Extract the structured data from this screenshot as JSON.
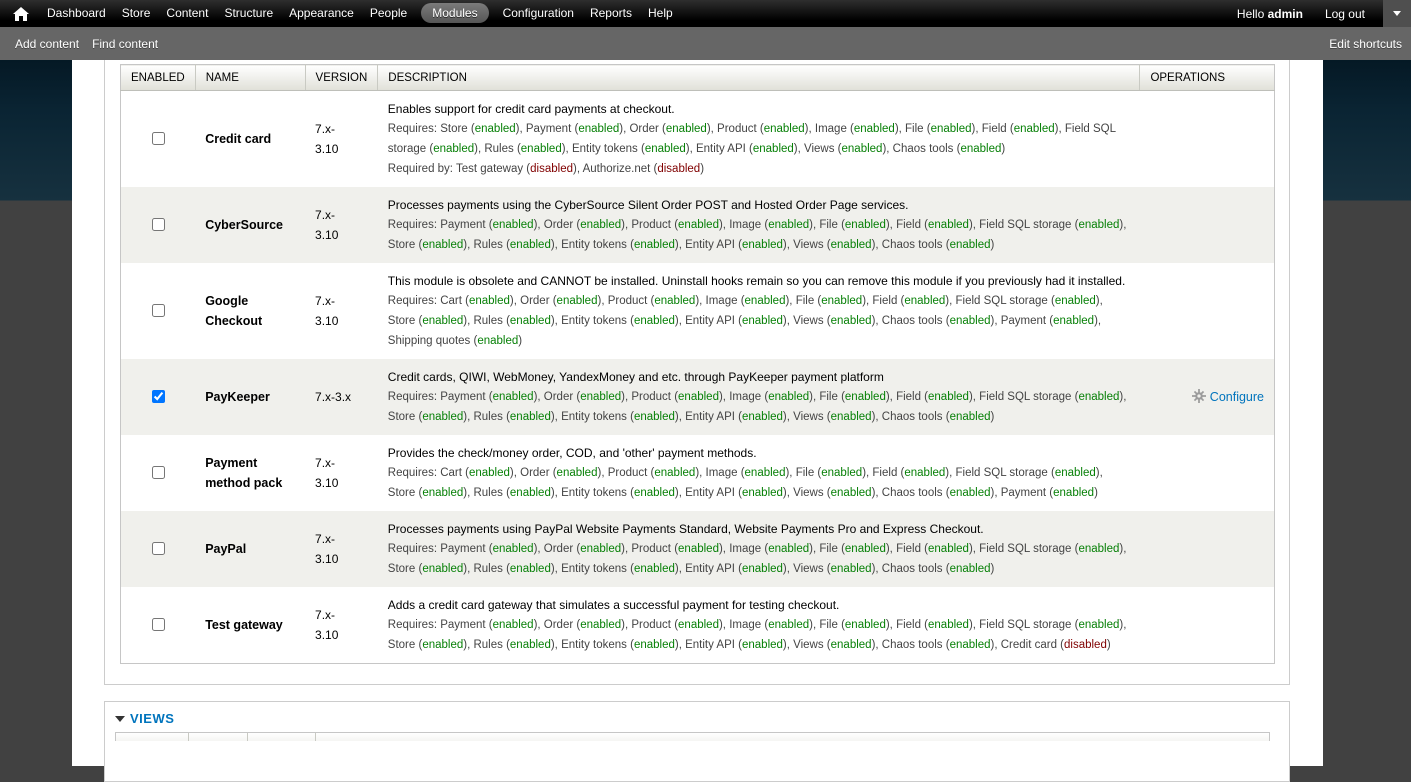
{
  "colors": {
    "link": "#0074bd",
    "status_enabled": "#078007",
    "status_disabled": "#800000",
    "toolbar_bg": "#000000",
    "shortcut_bar_bg": "#666666"
  },
  "toolbar": {
    "items": [
      {
        "label": "Dashboard"
      },
      {
        "label": "Store"
      },
      {
        "label": "Content"
      },
      {
        "label": "Structure"
      },
      {
        "label": "Appearance"
      },
      {
        "label": "People"
      },
      {
        "label": "Modules",
        "active": true
      },
      {
        "label": "Configuration"
      },
      {
        "label": "Reports"
      },
      {
        "label": "Help"
      }
    ],
    "greeting": "Hello",
    "username": "admin",
    "logout_label": "Log out"
  },
  "shortcuts": {
    "items": [
      {
        "label": "Add content"
      },
      {
        "label": "Find content"
      }
    ],
    "edit_label": "Edit shortcuts"
  },
  "modules_table": {
    "headers": [
      {
        "label": "ENABLED"
      },
      {
        "label": "NAME"
      },
      {
        "label": "VERSION"
      },
      {
        "label": "DESCRIPTION"
      },
      {
        "label": "OPERATIONS"
      }
    ],
    "rows": [
      {
        "name": "Credit card",
        "version": "7.x-3.10",
        "enabled": false,
        "operations_label": null,
        "description_lines": [
          {
            "text": "Enables support for credit card payments at checkout."
          },
          {
            "text": "Requires: Store (enabled), Payment (enabled), Order (enabled), Product (enabled), Image (enabled), File (enabled), Field (enabled), Field SQL storage (enabled), Rules (enabled), Entity tokens (enabled), Entity API (enabled), Views (enabled), Chaos tools (enabled)",
            "requirements": true
          },
          {
            "text": "Required by: Test gateway (disabled), Authorize.net (disabled)",
            "requirements": true
          }
        ]
      },
      {
        "name": "CyberSource",
        "version": "7.x-3.10",
        "enabled": false,
        "operations_label": null,
        "description_lines": [
          {
            "text": "Processes payments using the CyberSource Silent Order POST and Hosted Order Page services."
          },
          {
            "text": "Requires: Payment (enabled), Order (enabled), Product (enabled), Image (enabled), File (enabled), Field (enabled), Field SQL storage (enabled), Store (enabled), Rules (enabled), Entity tokens (enabled), Entity API (enabled), Views (enabled), Chaos tools (enabled)",
            "requirements": true
          }
        ]
      },
      {
        "name": "Google Checkout",
        "version": "7.x-3.10",
        "enabled": false,
        "operations_label": null,
        "description_lines": [
          {
            "text": "This module is obsolete and CANNOT be installed. Uninstall hooks remain so you can remove this module if you previously had it installed."
          },
          {
            "text": "Requires: Cart (enabled), Order (enabled), Product (enabled), Image (enabled), File (enabled), Field (enabled), Field SQL storage (enabled), Store (enabled), Rules (enabled), Entity tokens (enabled), Entity API (enabled), Views (enabled), Chaos tools (enabled), Payment (enabled), Shipping quotes (enabled)",
            "requirements": true
          }
        ]
      },
      {
        "name": "PayKeeper",
        "version": "7.x-3.x",
        "enabled": true,
        "version_single_line": true,
        "operations_label": "Configure",
        "description_lines": [
          {
            "text": "Credit cards, QIWI, WebMoney, YandexMoney and etc. through PayKeeper payment platform"
          },
          {
            "text": "Requires: Payment (enabled), Order (enabled), Product (enabled), Image (enabled), File (enabled), Field (enabled), Field SQL storage (enabled), Store (enabled), Rules (enabled), Entity tokens (enabled), Entity API (enabled), Views (enabled), Chaos tools (enabled)",
            "requirements": true
          }
        ]
      },
      {
        "name": "Payment method pack",
        "version": "7.x-3.10",
        "enabled": false,
        "operations_label": null,
        "description_lines": [
          {
            "text": "Provides the check/money order, COD, and 'other' payment methods."
          },
          {
            "text": "Requires: Cart (enabled), Order (enabled), Product (enabled), Image (enabled), File (enabled), Field (enabled), Field SQL storage (enabled), Store (enabled), Rules (enabled), Entity tokens (enabled), Entity API (enabled), Views (enabled), Chaos tools (enabled), Payment (enabled)",
            "requirements": true
          }
        ]
      },
      {
        "name": "PayPal",
        "version": "7.x-3.10",
        "enabled": false,
        "operations_label": null,
        "description_lines": [
          {
            "text": "Processes payments using PayPal Website Payments Standard, Website Payments Pro and Express Checkout."
          },
          {
            "text": "Requires: Payment (enabled), Order (enabled), Product (enabled), Image (enabled), File (enabled), Field (enabled), Field SQL storage (enabled), Store (enabled), Rules (enabled), Entity tokens (enabled), Entity API (enabled), Views (enabled), Chaos tools (enabled)",
            "requirements": true
          }
        ]
      },
      {
        "name": "Test gateway",
        "version": "7.x-3.10",
        "enabled": false,
        "operations_label": null,
        "description_lines": [
          {
            "text": "Adds a credit card gateway that simulates a successful payment for testing checkout."
          },
          {
            "text": "Requires: Payment (enabled), Order (enabled), Product (enabled), Image (enabled), File (enabled), Field (enabled), Field SQL storage (enabled), Store (enabled), Rules (enabled), Entity tokens (enabled), Entity API (enabled), Views (enabled), Chaos tools (enabled), Credit card (disabled)",
            "requirements": true
          }
        ]
      }
    ]
  },
  "views_section": {
    "title": "VIEWS"
  }
}
